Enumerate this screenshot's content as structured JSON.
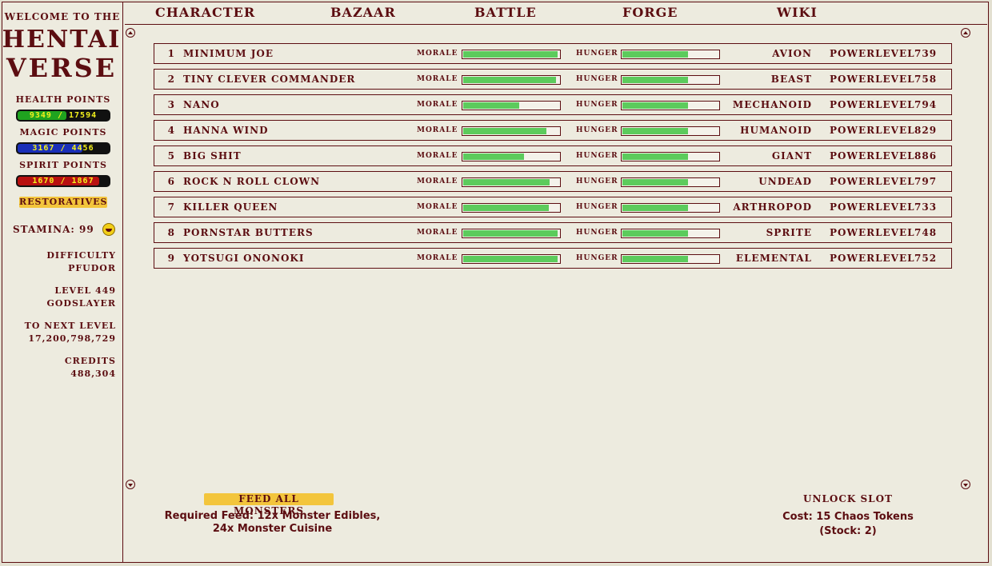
{
  "sidebar": {
    "welcome": "Welcome to the",
    "logo_line1": "HENTAI",
    "logo_line2": "VERSE",
    "health_label": "Health points",
    "health_value": "9349 / 17594",
    "health_fraction": 0.531,
    "magic_label": "Magic points",
    "magic_value": "3167 / 4456",
    "magic_fraction": 0.711,
    "spirit_label": "Spirit points",
    "spirit_value": "1670 / 1867",
    "spirit_fraction": 0.894,
    "restoratives_label": "Restoratives",
    "stamina": "Stamina: 99",
    "difficulty_label": "Difficulty",
    "difficulty_value": "PFUDOR",
    "level_label": "Level 449",
    "level_title": "Godslayer",
    "next_level_label": "To next level",
    "next_level_value": "17,200,798,729",
    "credits_label": "Credits",
    "credits_value": "488,304",
    "icons": {
      "stamina": "smiley-face-icon"
    }
  },
  "nav": {
    "items": [
      "Character",
      "Bazaar",
      "Battle",
      "Forge",
      "Wiki"
    ]
  },
  "monsters": {
    "morale_label": "Morale",
    "hunger_label": "Hunger",
    "powerlevel_label": "Powerlevel",
    "rows": [
      {
        "num": "1",
        "name": "Minimum Joe",
        "species": "Avion",
        "powerlevel": "739",
        "morale": 0.98,
        "hunger": 0.68
      },
      {
        "num": "2",
        "name": "Tiny Clever Commander",
        "species": "Beast",
        "powerlevel": "758",
        "morale": 0.97,
        "hunger": 0.68
      },
      {
        "num": "3",
        "name": "Nano",
        "species": "Mechanoid",
        "powerlevel": "794",
        "morale": 0.58,
        "hunger": 0.68
      },
      {
        "num": "4",
        "name": "Hanna Wind",
        "species": "Humanoid",
        "powerlevel": "829",
        "morale": 0.87,
        "hunger": 0.68
      },
      {
        "num": "5",
        "name": "Big Shit",
        "species": "Giant",
        "powerlevel": "886",
        "morale": 0.63,
        "hunger": 0.68
      },
      {
        "num": "6",
        "name": "Rock N Roll Clown",
        "species": "Undead",
        "powerlevel": "797",
        "morale": 0.9,
        "hunger": 0.68
      },
      {
        "num": "7",
        "name": "Killer Queen",
        "species": "Arthropod",
        "powerlevel": "733",
        "morale": 0.89,
        "hunger": 0.68
      },
      {
        "num": "8",
        "name": "Pornstar Butters",
        "species": "Sprite",
        "powerlevel": "748",
        "morale": 0.98,
        "hunger": 0.68
      },
      {
        "num": "9",
        "name": "Yotsugi Ononoki",
        "species": "Elemental",
        "powerlevel": "752",
        "morale": 0.98,
        "hunger": 0.68
      }
    ]
  },
  "bottom": {
    "feed_button": "Feed all monsters",
    "feed_req_line1": "Required Feed: 12x Monster Edibles,",
    "feed_req_line2": "24x Monster Cuisine",
    "unlock_label": "Unlock Slot",
    "unlock_cost": "Cost: 15 Chaos Tokens",
    "unlock_stock": "(Stock: 2)"
  },
  "colors": {
    "text": "#5C0D11",
    "background": "#EDEBDF",
    "button": "#F3C53C",
    "bar_fill": "#5CCB5C"
  }
}
